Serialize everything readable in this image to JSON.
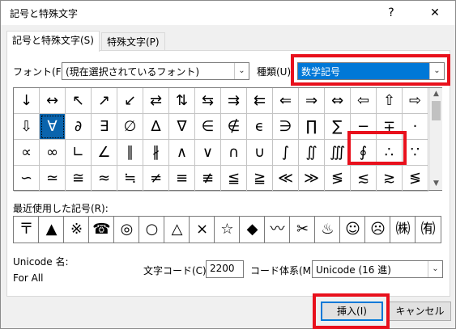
{
  "window": {
    "title": "記号と特殊文字",
    "help_label": "?",
    "close_label": "✕"
  },
  "tabs": [
    {
      "label": "記号と特殊文字(S)"
    },
    {
      "label": "特殊文字(P)"
    }
  ],
  "font": {
    "label": "フォント(F):",
    "value": "(現在選択されているフォント)"
  },
  "subset": {
    "label": "種類(U):",
    "value": "数学記号"
  },
  "symbols": [
    [
      "↓",
      "↔",
      "↖",
      "↗",
      "↙",
      "⇄",
      "⇅",
      "⇆",
      "⇉",
      "⇇",
      "⇐",
      "⇒",
      "⇔",
      "⇦",
      "⇧",
      "⇨"
    ],
    [
      "⇩",
      "∀",
      "∂",
      "∃",
      "∅",
      "∆",
      "∇",
      "∈",
      "∉",
      "ϵ",
      "∋",
      "∏",
      "∑",
      "−",
      "∓",
      "·",
      "√"
    ],
    [
      "∝",
      "∞",
      "∟",
      "∠",
      "∥",
      "∦",
      "∧",
      "∨",
      "∩",
      "∪",
      "∫",
      "∬",
      "∭",
      "∮",
      "∴",
      "∵",
      "∼"
    ],
    [
      "∽",
      "≃",
      "≅",
      "≈",
      "≒",
      "≠",
      "≡",
      "≢",
      "≦",
      "≧",
      "≪",
      "≫",
      "≶",
      "≲",
      "≳",
      "≶"
    ]
  ],
  "recent": {
    "label": "最近使用した記号(R):",
    "items": [
      "〒",
      "▲",
      "※",
      "☎",
      "◎",
      "○",
      "△",
      "×",
      "☆",
      "◆",
      "〰",
      "✂",
      "♨",
      "☺",
      "☹",
      "㈱",
      "㈲"
    ]
  },
  "unicode_name": {
    "label": "Unicode 名:",
    "value": "For All"
  },
  "char_code": {
    "label": "文字コード(C):",
    "value": "2200"
  },
  "code_system": {
    "label": "コード体系(M):",
    "value": "Unicode (16 進)"
  },
  "buttons": {
    "insert": "挿入(I)",
    "cancel": "キャンセル"
  },
  "colors": {
    "selection": "#0a64ad",
    "highlight": "#e8101c"
  },
  "icons": {
    "scroll_up": "▲",
    "scroll_down": "▼",
    "dropdown": "chevron-down-icon"
  }
}
